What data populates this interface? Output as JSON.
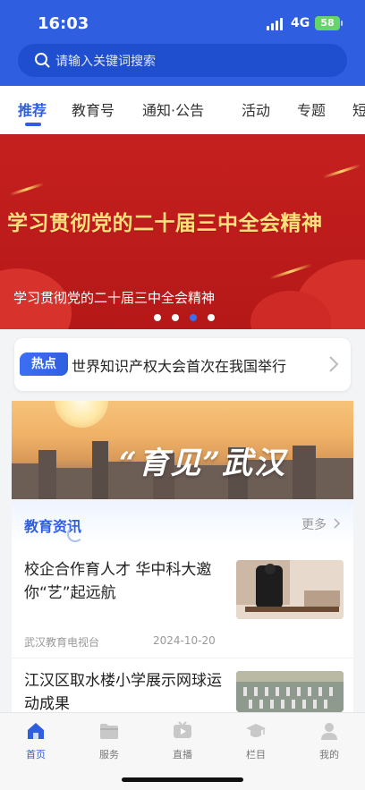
{
  "status": {
    "time": "16:03",
    "network": "4G",
    "battery": "58"
  },
  "search": {
    "placeholder": "请输入关键词搜索"
  },
  "tabs": [
    {
      "label": "推荐",
      "active": true
    },
    {
      "label": "教育号"
    },
    {
      "label": "通知·公告"
    },
    {
      "label": "活动"
    },
    {
      "label": "专题"
    },
    {
      "label": "短"
    }
  ],
  "banner": {
    "headline": "学习贯彻党的二十届三中全会精神",
    "caption": "学习贯彻党的二十届三中全会精神",
    "dot_count": 4,
    "active_dot": 2
  },
  "hot": {
    "badge": "热点",
    "text": "世界知识产权大会首次在我国举行"
  },
  "promo": {
    "slogan": "“育见”武汉"
  },
  "news": {
    "section_title": "教育资讯",
    "more_label": "更多",
    "items": [
      {
        "title": "校企合作育人才  华中科大邀你“艺”起远航",
        "source": "武汉教育电视台",
        "date": "2024-10-20"
      },
      {
        "title": "江汉区取水楼小学展示网球运动成果",
        "source": "",
        "date": ""
      }
    ]
  },
  "bottom_nav": [
    {
      "label": "首页",
      "icon": "home-icon",
      "active": true
    },
    {
      "label": "服务",
      "icon": "folder-icon"
    },
    {
      "label": "直播",
      "icon": "tv-icon"
    },
    {
      "label": "栏目",
      "icon": "graduation-cap-icon"
    },
    {
      "label": "我的",
      "icon": "user-icon"
    }
  ],
  "colors": {
    "accent": "#2f5fe0",
    "banner_red": "#c5201f",
    "headline_gold": "#ffe07a"
  }
}
